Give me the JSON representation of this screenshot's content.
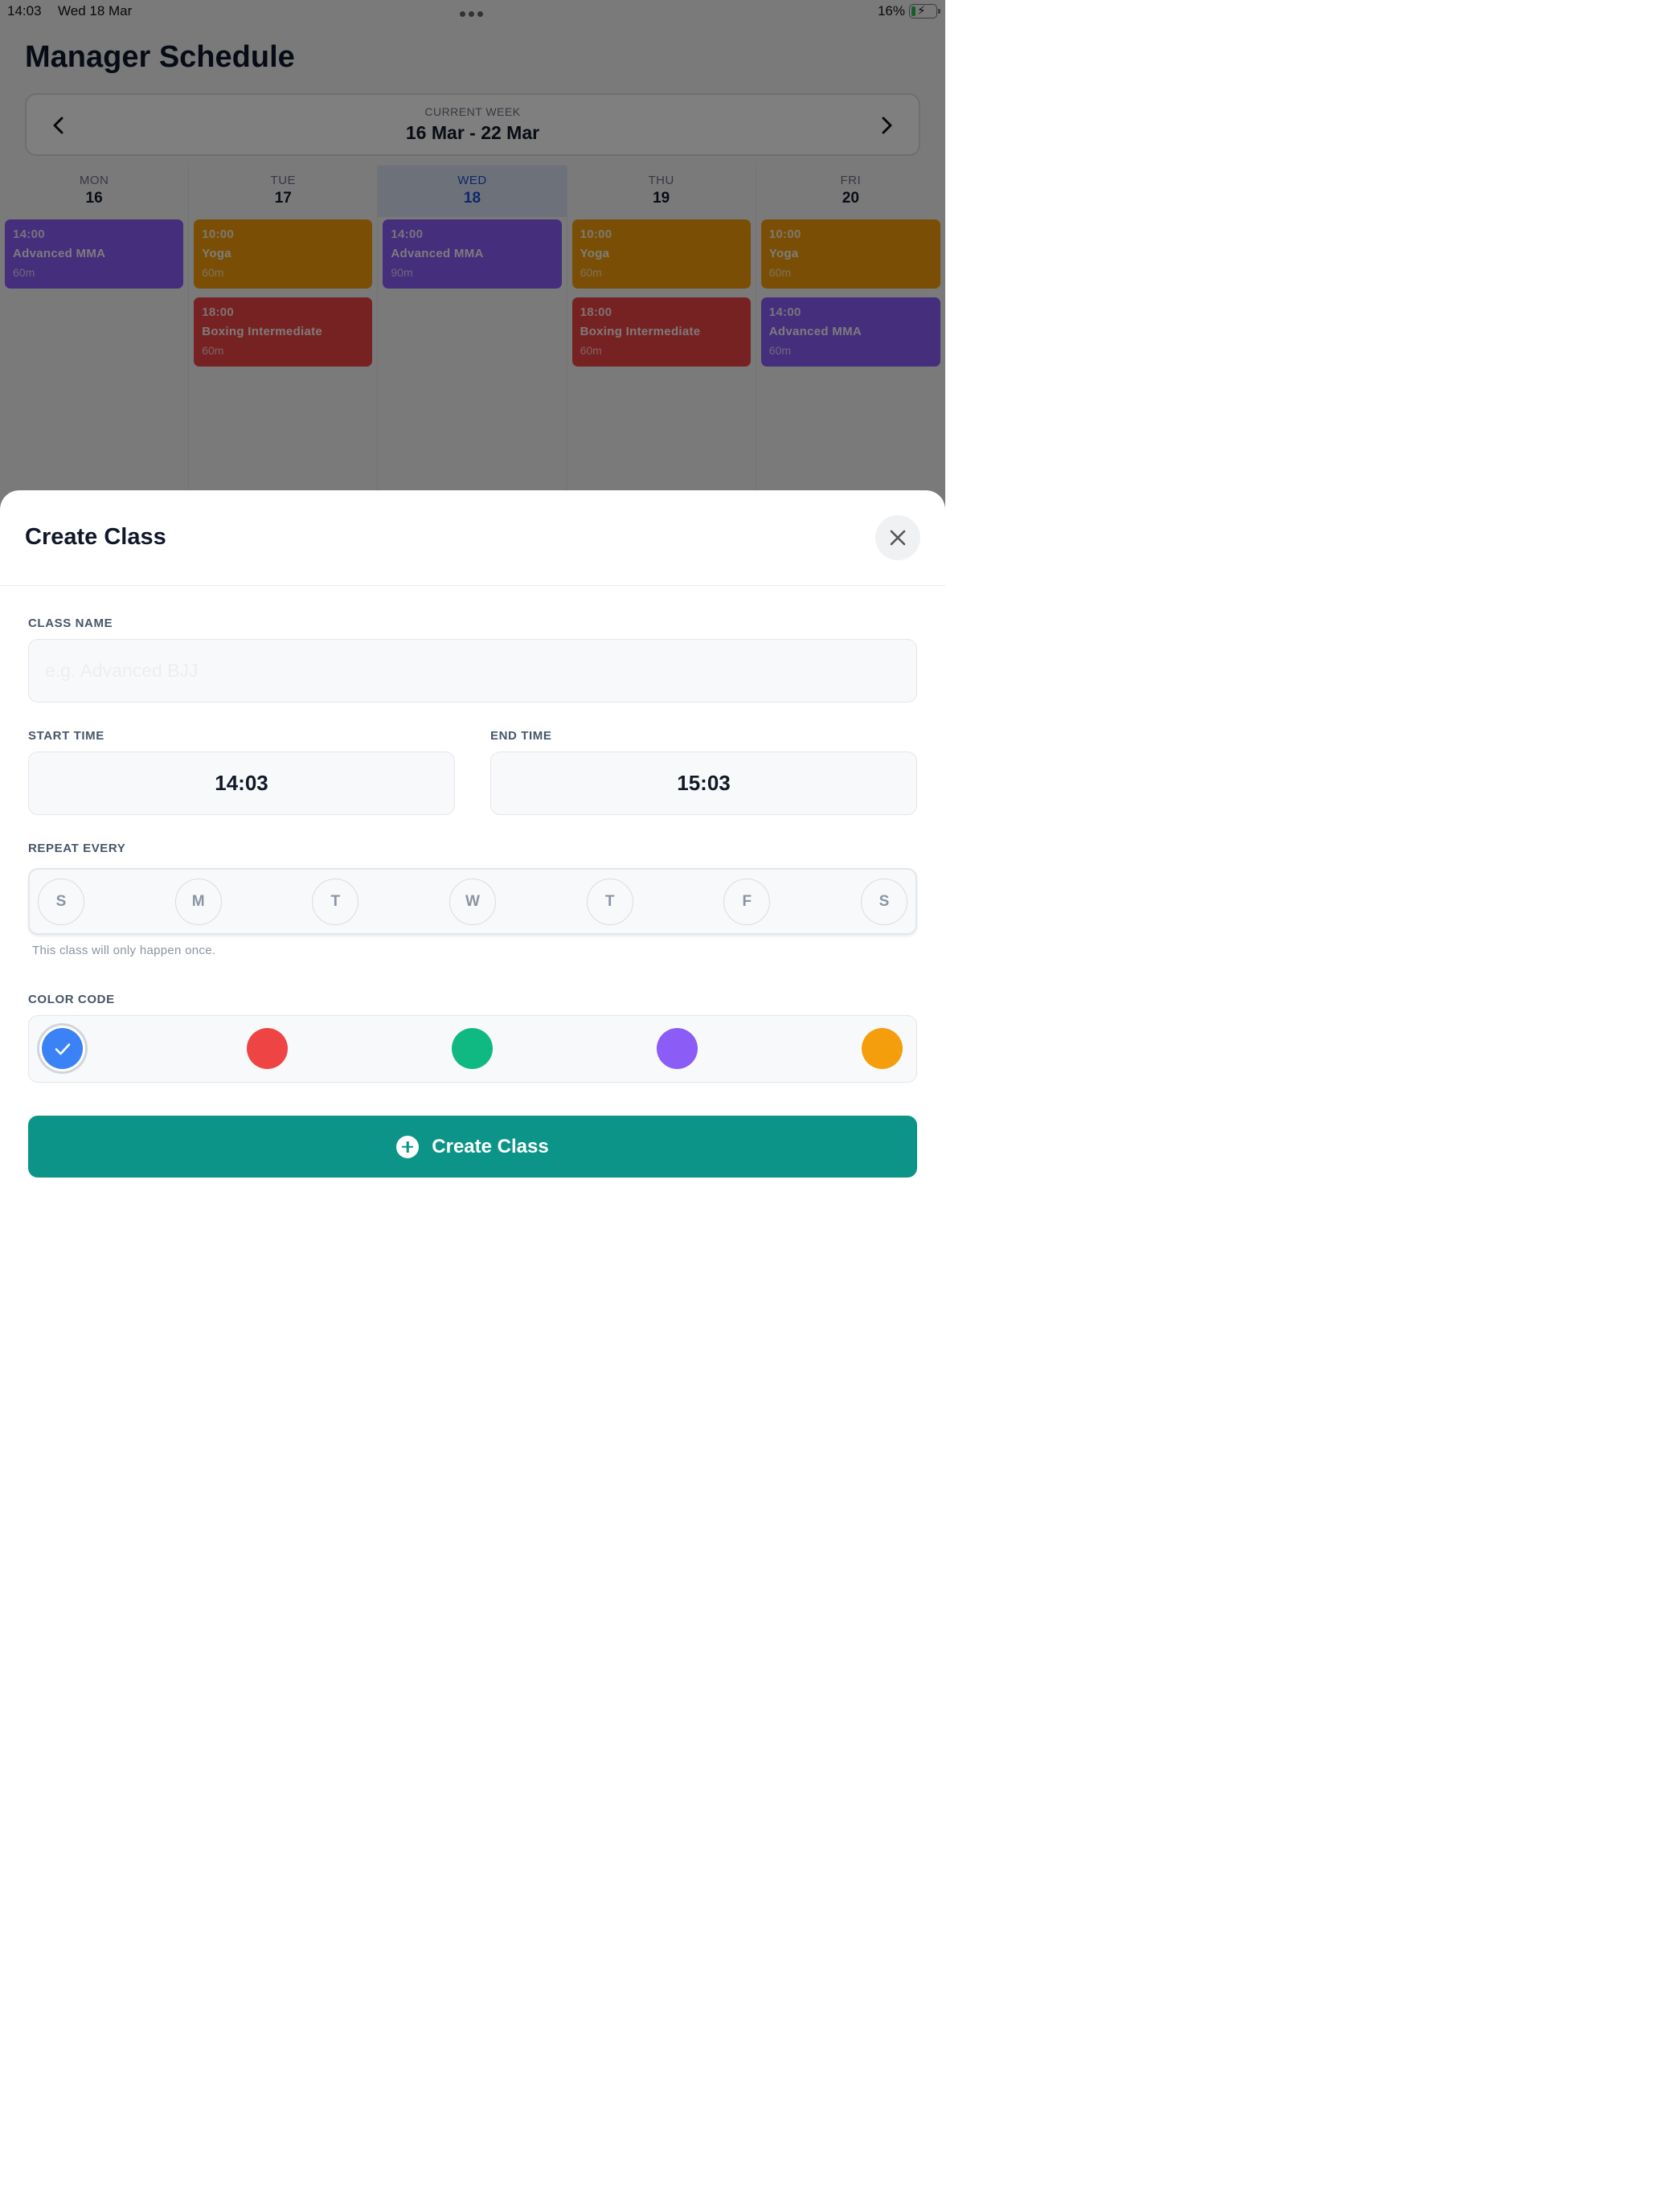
{
  "status_bar": {
    "time": "14:03",
    "date": "Wed 18 Mar",
    "battery": "16%"
  },
  "background": {
    "title": "Manager Schedule",
    "week": {
      "label": "CURRENT WEEK",
      "range": "16 Mar - 22 Mar"
    },
    "days": [
      {
        "name": "MON",
        "num": "16",
        "today": false,
        "events": [
          {
            "time": "14:00",
            "name": "Advanced MMA",
            "duration": "60m",
            "color": "#8b5cf6"
          }
        ]
      },
      {
        "name": "TUE",
        "num": "17",
        "today": false,
        "events": [
          {
            "time": "10:00",
            "name": "Yoga",
            "duration": "60m",
            "color": "#f59e0b"
          },
          {
            "time": "18:00",
            "name": "Boxing Intermediate",
            "duration": "60m",
            "color": "#ef4444"
          }
        ]
      },
      {
        "name": "WED",
        "num": "18",
        "today": true,
        "events": [
          {
            "time": "14:00",
            "name": "Advanced MMA",
            "duration": "90m",
            "color": "#8b5cf6"
          }
        ]
      },
      {
        "name": "THU",
        "num": "19",
        "today": false,
        "events": [
          {
            "time": "10:00",
            "name": "Yoga",
            "duration": "60m",
            "color": "#f59e0b"
          },
          {
            "time": "18:00",
            "name": "Boxing Intermediate",
            "duration": "60m",
            "color": "#ef4444"
          }
        ]
      },
      {
        "name": "FRI",
        "num": "20",
        "today": false,
        "events": [
          {
            "time": "10:00",
            "name": "Yoga",
            "duration": "60m",
            "color": "#f59e0b"
          },
          {
            "time": "14:00",
            "name": "Advanced MMA",
            "duration": "60m",
            "color": "#8b5cf6"
          }
        ]
      }
    ]
  },
  "sheet": {
    "title": "Create Class",
    "class_name": {
      "label": "CLASS NAME",
      "placeholder": "e.g. Advanced BJJ",
      "value": ""
    },
    "start_time": {
      "label": "START TIME",
      "value": "14:03"
    },
    "end_time": {
      "label": "END TIME",
      "value": "15:03"
    },
    "repeat": {
      "label": "REPEAT EVERY",
      "days": [
        "S",
        "M",
        "T",
        "W",
        "T",
        "F",
        "S"
      ],
      "hint": "This class will only happen once."
    },
    "color_code": {
      "label": "COLOR CODE",
      "colors": [
        "#3b82f6",
        "#ef4444",
        "#10b981",
        "#8b5cf6",
        "#f59e0b"
      ],
      "selected": "#3b82f6"
    },
    "submit_label": "Create Class"
  }
}
